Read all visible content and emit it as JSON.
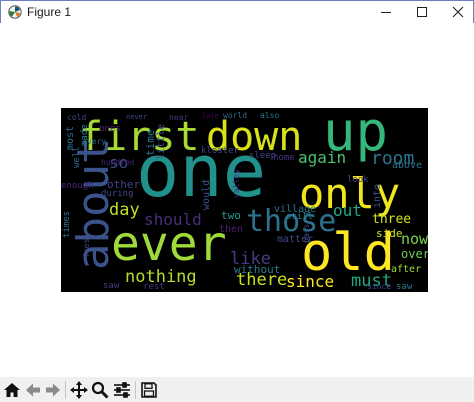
{
  "window": {
    "title": "Figure 1"
  },
  "toolbar": {
    "buttons": [
      {
        "name": "home-button",
        "icon": "home-icon"
      },
      {
        "name": "back-button",
        "icon": "left-arrow-icon"
      },
      {
        "name": "forward-button",
        "icon": "right-arrow-icon"
      },
      {
        "name": "pan-button",
        "icon": "move-icon"
      },
      {
        "name": "zoom-button",
        "icon": "magnifier-icon"
      },
      {
        "name": "configure-subplots-button",
        "icon": "sliders-icon"
      },
      {
        "name": "save-button",
        "icon": "floppy-icon"
      }
    ]
  },
  "wordcloud": {
    "words": [
      {
        "text": "first",
        "color": "#a8db34"
      },
      {
        "text": "down",
        "color": "#d8e219"
      },
      {
        "text": "up",
        "color": "#35b779"
      },
      {
        "text": "one",
        "color": "#21918c"
      },
      {
        "text": "about",
        "color": "#3b528b"
      },
      {
        "text": "only",
        "color": "#f1e51d"
      },
      {
        "text": "ever",
        "color": "#9fda3a"
      },
      {
        "text": "old",
        "color": "#fde725"
      },
      {
        "text": "those",
        "color": "#2c728e"
      },
      {
        "text": "room",
        "color": "#2a788e"
      },
      {
        "text": "again",
        "color": "#4ac16d"
      },
      {
        "text": "day",
        "color": "#bddf26"
      },
      {
        "text": "so",
        "color": "#3e4989"
      },
      {
        "text": "should",
        "color": "#472d7b"
      },
      {
        "text": "out",
        "color": "#22a884"
      },
      {
        "text": "three",
        "color": "#d2e21b"
      },
      {
        "text": "now",
        "color": "#7ad151"
      },
      {
        "text": "nothing",
        "color": "#b5de2b"
      },
      {
        "text": "there",
        "color": "#cae11f"
      },
      {
        "text": "since",
        "color": "#fde725"
      },
      {
        "text": "must",
        "color": "#22a884"
      },
      {
        "text": "like",
        "color": "#433e85"
      },
      {
        "text": "without",
        "color": "#2a788e"
      },
      {
        "text": "two",
        "color": "#1f9e89"
      },
      {
        "text": "side",
        "color": "#d8e219"
      },
      {
        "text": "into",
        "color": "#3b528b"
      },
      {
        "text": "over",
        "color": "#6ece58"
      },
      {
        "text": "after",
        "color": "#9fda3a"
      },
      {
        "text": "matter",
        "color": "#3e4989"
      },
      {
        "text": "other",
        "color": "#404688"
      },
      {
        "text": "most",
        "color": "#2c728e"
      },
      {
        "text": "well",
        "color": "#31688e"
      },
      {
        "text": "made",
        "color": "#26828e"
      },
      {
        "text": "ones",
        "color": "#482878"
      },
      {
        "text": "cold",
        "color": "#3e4989"
      },
      {
        "text": "time",
        "color": "#2c728e"
      },
      {
        "text": "little",
        "color": "#3b528b"
      },
      {
        "text": "near",
        "color": "#46337f"
      },
      {
        "text": "never",
        "color": "#3f4788"
      },
      {
        "text": "late",
        "color": "#440154"
      },
      {
        "text": "world",
        "color": "#31688e"
      },
      {
        "text": "also",
        "color": "#2a788e"
      },
      {
        "text": "sleep",
        "color": "#3e4989"
      },
      {
        "text": "home",
        "color": "#46337f"
      },
      {
        "text": "kloster",
        "color": "#404688"
      },
      {
        "text": "hundred",
        "color": "#482576"
      },
      {
        "text": "would",
        "color": "#3b528b"
      },
      {
        "text": "village",
        "color": "#2c728e"
      },
      {
        "text": "still",
        "color": "#26828e"
      },
      {
        "text": "look",
        "color": "#433e85"
      },
      {
        "text": "above",
        "color": "#2c728e"
      },
      {
        "text": "enough",
        "color": "#482878"
      },
      {
        "text": "during",
        "color": "#3e4989"
      },
      {
        "text": "then",
        "color": "#481f70"
      },
      {
        "text": "times",
        "color": "#2c728e"
      },
      {
        "text": "fresh",
        "color": "#404688"
      },
      {
        "text": "saw",
        "color": "#433e85"
      },
      {
        "text": "saw",
        "color": "#2a788e"
      },
      {
        "text": "rest",
        "color": "#46337f"
      },
      {
        "text": "valley",
        "color": "#482878"
      },
      {
        "text": "every",
        "color": "#31688e"
      },
      {
        "text": "pass",
        "color": "#3b528b"
      },
      {
        "text": "since",
        "color": "#3e4989"
      }
    ]
  }
}
